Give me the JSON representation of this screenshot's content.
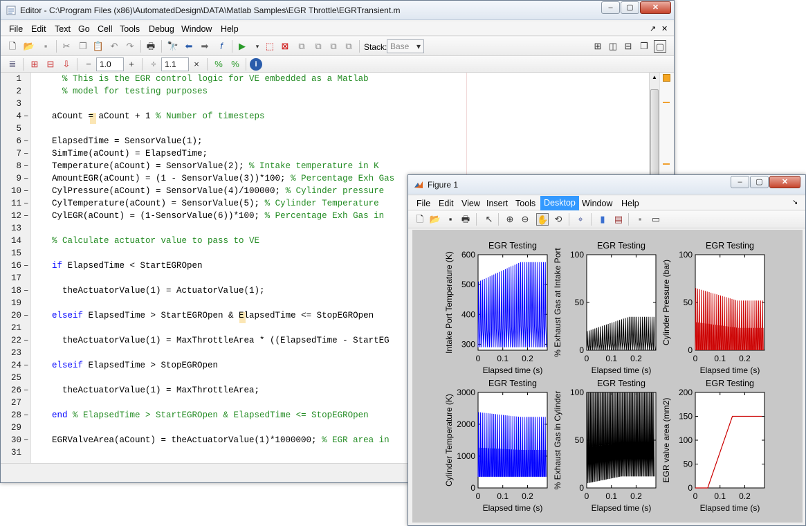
{
  "editor": {
    "title": "Editor - C:\\Program Files (x86)\\AutomatedDesign\\DATA\\Matlab Samples\\EGR Throttle\\EGRTransient.m",
    "menus": [
      "File",
      "Edit",
      "Text",
      "Go",
      "Cell",
      "Tools",
      "Debug",
      "Window",
      "Help"
    ],
    "stack_label": "Stack:",
    "stack_value": "Base",
    "minus_value": "1.0",
    "divide_value": "1.1",
    "lines": [
      {
        "n": "1",
        "bp": "",
        "parts": [
          {
            "t": "  % This is the EGR control logic for VE embedded as a Matlab",
            "c": "cm"
          }
        ]
      },
      {
        "n": "2",
        "bp": "",
        "parts": [
          {
            "t": "  % model for testing purposes",
            "c": "cm"
          }
        ]
      },
      {
        "n": "3",
        "bp": "",
        "parts": []
      },
      {
        "n": "4",
        "bp": "–",
        "parts": [
          {
            "t": "aCount = aCount + 1 ",
            "c": ""
          },
          {
            "t": "% Number of timesteps",
            "c": "cm"
          }
        ]
      },
      {
        "n": "5",
        "bp": "",
        "parts": []
      },
      {
        "n": "6",
        "bp": "–",
        "parts": [
          {
            "t": "ElapsedTime = SensorValue(1);",
            "c": ""
          }
        ]
      },
      {
        "n": "7",
        "bp": "–",
        "parts": [
          {
            "t": "SimTime(aCount) = ElapsedTime;",
            "c": ""
          }
        ]
      },
      {
        "n": "8",
        "bp": "–",
        "parts": [
          {
            "t": "Temperature(aCount) = SensorValue(2); ",
            "c": ""
          },
          {
            "t": "% Intake temperature in K",
            "c": "cm"
          }
        ]
      },
      {
        "n": "9",
        "bp": "–",
        "parts": [
          {
            "t": "AmountEGR(aCount) = (1 - SensorValue(3))*100; ",
            "c": ""
          },
          {
            "t": "% Percentage Exh Gas",
            "c": "cm"
          }
        ]
      },
      {
        "n": "10",
        "bp": "–",
        "parts": [
          {
            "t": "CylPressure(aCount) = SensorValue(4)/100000; ",
            "c": ""
          },
          {
            "t": "% Cylinder pressure",
            "c": "cm"
          }
        ]
      },
      {
        "n": "11",
        "bp": "–",
        "parts": [
          {
            "t": "CylTemperature(aCount) = SensorValue(5); ",
            "c": ""
          },
          {
            "t": "% Cylinder Temperature",
            "c": "cm"
          }
        ]
      },
      {
        "n": "12",
        "bp": "–",
        "parts": [
          {
            "t": "CylEGR(aCount) = (1-SensorValue(6))*100; ",
            "c": ""
          },
          {
            "t": "% Percentage Exh Gas in",
            "c": "cm"
          }
        ]
      },
      {
        "n": "13",
        "bp": "",
        "parts": []
      },
      {
        "n": "14",
        "bp": "",
        "parts": [
          {
            "t": "% Calculate actuator value to pass to VE",
            "c": "cm"
          }
        ]
      },
      {
        "n": "15",
        "bp": "",
        "parts": []
      },
      {
        "n": "16",
        "bp": "–",
        "parts": [
          {
            "t": "if",
            "c": "kw"
          },
          {
            "t": " ElapsedTime < StartEGROpen",
            "c": ""
          }
        ]
      },
      {
        "n": "17",
        "bp": "",
        "parts": []
      },
      {
        "n": "18",
        "bp": "–",
        "parts": [
          {
            "t": "  theActuatorValue(1) = ActuatorValue(1);",
            "c": ""
          }
        ]
      },
      {
        "n": "19",
        "bp": "",
        "parts": []
      },
      {
        "n": "20",
        "bp": "–",
        "parts": [
          {
            "t": "elseif",
            "c": "kw"
          },
          {
            "t": " ElapsedTime > StartEGROpen & ElapsedTime <= StopEGROpen",
            "c": ""
          }
        ]
      },
      {
        "n": "21",
        "bp": "",
        "parts": []
      },
      {
        "n": "22",
        "bp": "–",
        "parts": [
          {
            "t": "  theActuatorValue(1) = MaxThrottleArea * ((ElapsedTime - StartEG",
            "c": ""
          }
        ]
      },
      {
        "n": "23",
        "bp": "",
        "parts": []
      },
      {
        "n": "24",
        "bp": "–",
        "parts": [
          {
            "t": "elseif",
            "c": "kw"
          },
          {
            "t": " ElapsedTime > StopEGROpen",
            "c": ""
          }
        ]
      },
      {
        "n": "25",
        "bp": "",
        "parts": []
      },
      {
        "n": "26",
        "bp": "–",
        "parts": [
          {
            "t": "  theActuatorValue(1) = MaxThrottleArea;",
            "c": ""
          }
        ]
      },
      {
        "n": "27",
        "bp": "",
        "parts": []
      },
      {
        "n": "28",
        "bp": "–",
        "parts": [
          {
            "t": "end",
            "c": "kw"
          },
          {
            "t": " % ElapsedTime > StartEGROpen & ElapsedTime <= StopEGROpen",
            "c": "cm"
          }
        ]
      },
      {
        "n": "29",
        "bp": "",
        "parts": []
      },
      {
        "n": "30",
        "bp": "–",
        "parts": [
          {
            "t": "EGRValveArea(aCount) = theActuatorValue(1)*1000000; ",
            "c": ""
          },
          {
            "t": "% EGR area in",
            "c": "cm"
          }
        ]
      },
      {
        "n": "31",
        "bp": "",
        "parts": []
      }
    ]
  },
  "figure": {
    "title": "Figure 1",
    "menus": [
      "File",
      "Edit",
      "View",
      "Insert",
      "Tools",
      "Desktop",
      "Window",
      "Help"
    ],
    "active_menu": "Desktop"
  },
  "chart_data": [
    {
      "type": "line",
      "title": "EGR Testing",
      "xlabel": "Elapsed time (s)",
      "ylabel": "Intake Port Temperature (K)",
      "xlim": [
        0,
        0.28
      ],
      "ylim": [
        280,
        600
      ],
      "yticks": [
        300,
        400,
        500,
        600
      ],
      "xticks": [
        0,
        0.1,
        0.2
      ],
      "series": [
        {
          "color": "#0000ff",
          "pattern": "oscillating",
          "max": [
            510,
            575
          ],
          "min": [
            290,
            290
          ]
        }
      ]
    },
    {
      "type": "line",
      "title": "EGR Testing",
      "xlabel": "Elapsed time (s)",
      "ylabel": "% Exhaust Gas at Intake Port",
      "xlim": [
        0,
        0.28
      ],
      "ylim": [
        0,
        100
      ],
      "yticks": [
        0,
        50,
        100
      ],
      "xticks": [
        0,
        0.1,
        0.2
      ],
      "series": [
        {
          "color": "#000000",
          "pattern": "oscillating",
          "max": [
            20,
            35
          ],
          "min": [
            0,
            0
          ]
        }
      ]
    },
    {
      "type": "line",
      "title": "EGR Testing",
      "xlabel": "Elapsed time (s)",
      "ylabel": "Cylinder Pressure (bar)",
      "xlim": [
        0,
        0.28
      ],
      "ylim": [
        0,
        100
      ],
      "yticks": [
        0,
        50,
        100
      ],
      "xticks": [
        0,
        0.1,
        0.2
      ],
      "series": [
        {
          "color": "#cc0000",
          "pattern": "spikes",
          "max": [
            65,
            52
          ],
          "min": [
            0,
            0
          ]
        }
      ]
    },
    {
      "type": "line",
      "title": "EGR Testing",
      "xlabel": "Elapsed time (s)",
      "ylabel": "Cylinder Temperature (K)",
      "xlim": [
        0,
        0.28
      ],
      "ylim": [
        0,
        3000
      ],
      "yticks": [
        0,
        1000,
        2000,
        3000
      ],
      "xticks": [
        0,
        0.1,
        0.2
      ],
      "series": [
        {
          "color": "#0000ff",
          "pattern": "spikes",
          "max": [
            2380,
            2230
          ],
          "min": [
            350,
            350
          ]
        }
      ]
    },
    {
      "type": "line",
      "title": "EGR Testing",
      "xlabel": "Elapsed time (s)",
      "ylabel": "% Exhaust Gas in Cylinder",
      "xlim": [
        0,
        0.28
      ],
      "ylim": [
        0,
        100
      ],
      "yticks": [
        0,
        50,
        100
      ],
      "xticks": [
        0,
        0.1,
        0.2
      ],
      "series": [
        {
          "color": "#000000",
          "pattern": "dense",
          "max": [
            100,
            100
          ],
          "min": [
            5,
            12
          ]
        }
      ]
    },
    {
      "type": "line",
      "title": "EGR Testing",
      "xlabel": "Elapsed time (s)",
      "ylabel": "EGR valve area (mm2)",
      "xlim": [
        0,
        0.28
      ],
      "ylim": [
        0,
        200
      ],
      "yticks": [
        0,
        50,
        100,
        150,
        200
      ],
      "xticks": [
        0,
        0.1,
        0.2
      ],
      "series": [
        {
          "color": "#cc0000",
          "pattern": "ramp",
          "x": [
            0,
            0.05,
            0.15,
            0.27
          ],
          "y": [
            0,
            0,
            150,
            150
          ]
        }
      ]
    }
  ]
}
